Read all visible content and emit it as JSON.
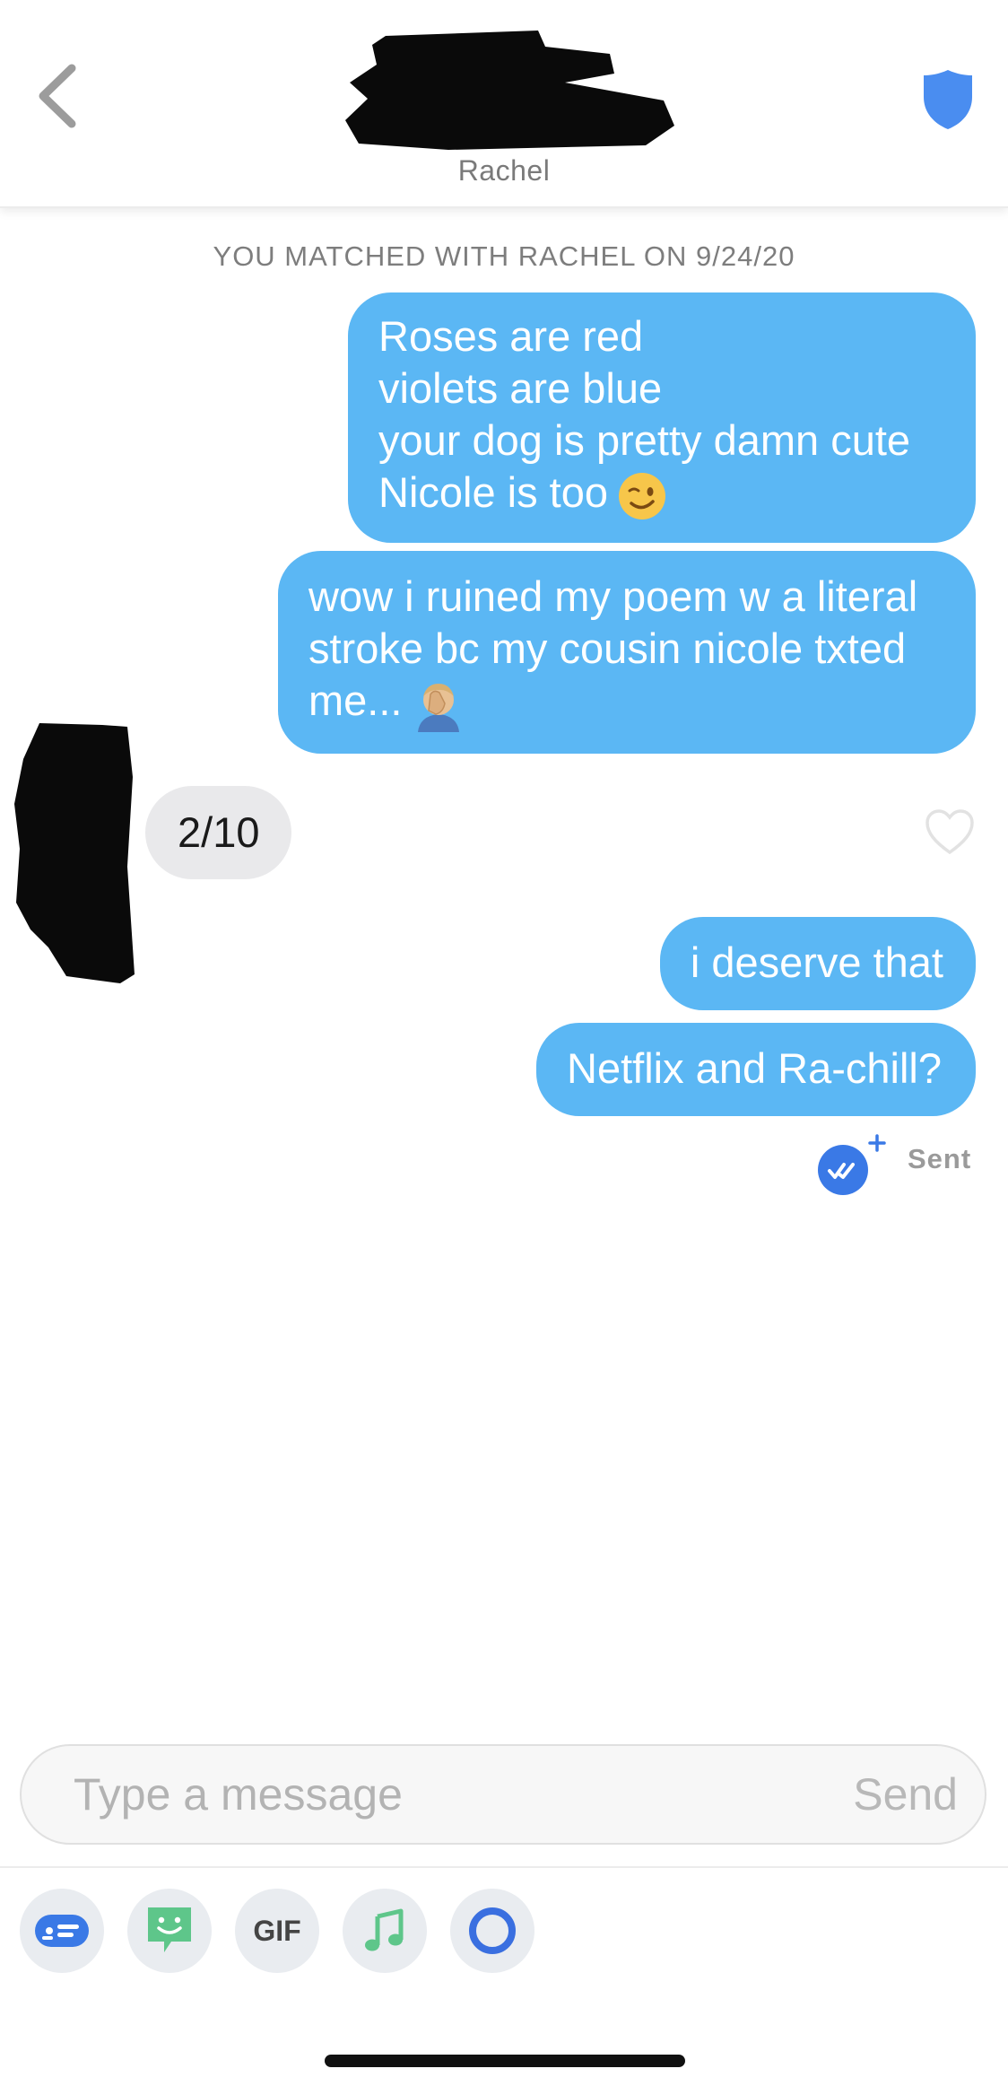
{
  "header": {
    "name": "Rachel",
    "back_icon": "chevron-left-icon",
    "safety_icon": "shield-icon"
  },
  "match_notice": "YOU MATCHED WITH RACHEL ON 9/24/20",
  "messages": [
    {
      "from": "me",
      "lines": [
        "Roses are red",
        "violets are blue",
        "your dog is pretty damn cute",
        "Nicole is too"
      ],
      "emoji": "winking-face"
    },
    {
      "from": "me",
      "lines": [
        "wow i ruined my poem w a literal",
        "stroke bc my cousin nicole txted",
        "me..."
      ],
      "emoji": "facepalm"
    },
    {
      "from": "them",
      "text": "2/10"
    },
    {
      "from": "me",
      "text": "i deserve that"
    },
    {
      "from": "me",
      "text": "Netflix and Ra-chill?"
    }
  ],
  "status": {
    "text": "Sent",
    "icon": "read-receipt-icon"
  },
  "composer": {
    "placeholder": "Type a message",
    "send_label": "Send"
  },
  "toolbar": {
    "items": [
      {
        "icon": "card-icon"
      },
      {
        "icon": "sticker-icon"
      },
      {
        "label": "GIF",
        "icon": "gif-icon"
      },
      {
        "icon": "music-icon"
      },
      {
        "icon": "ring-icon"
      }
    ]
  },
  "colors": {
    "outgoing_bubble": "#5bb7f4",
    "incoming_bubble": "#e9e9eb",
    "accent_blue": "#3a79e6",
    "safety_blue": "#4a8df0"
  }
}
